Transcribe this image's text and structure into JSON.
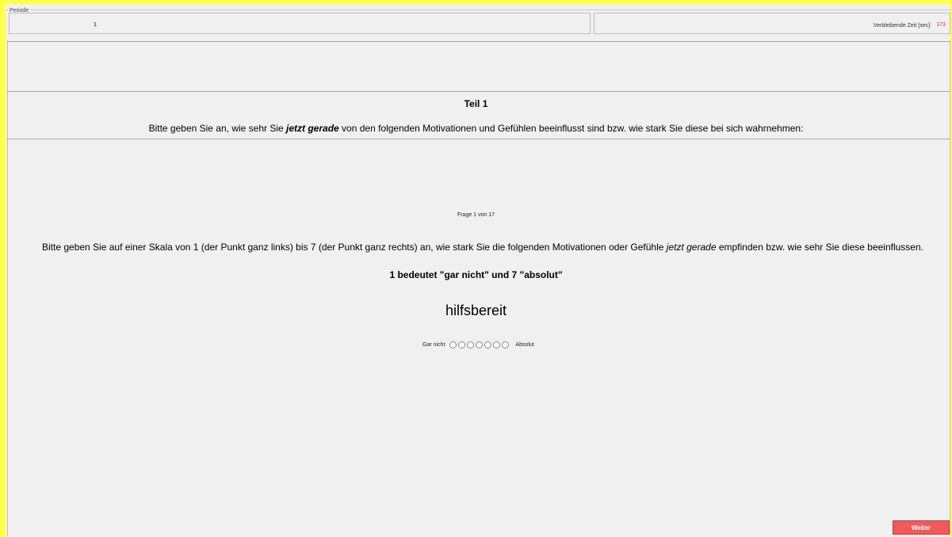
{
  "header": {
    "legend": "Periode",
    "periode_value": "1",
    "time_label": "Verbleibende Zeit [sec]:",
    "time_value": "173"
  },
  "intro": {
    "title": "Teil 1",
    "text_before": "Bitte geben Sie an, wie sehr Sie ",
    "text_emph": "jetzt gerade",
    "text_after": " von den folgenden Motivationen und Gefühlen beeinflusst sind bzw. wie stark Sie diese bei sich wahrnehmen:"
  },
  "question": {
    "counter": "Frage 1 von 17",
    "instr_before": "Bitte geben Sie auf einer Skala von 1 (der Punkt ganz links) bis 7 (der Punkt ganz rechts) an, wie stark Sie die folgenden Motivationen oder Gefühle ",
    "instr_emph": "jetzt gerade",
    "instr_after": " empfinden bzw. wie sehr Sie diese beeinflussen.",
    "scale_note": "1 bedeutet \"gar nicht\" und 7 \"absolut\"",
    "item": "hilfsbereit",
    "scale_min_label": "Gar nicht",
    "scale_max_label": "Absolut",
    "scale_points": 7,
    "selected": null
  },
  "footer": {
    "next_label": "Weiter"
  },
  "colors": {
    "frame": "#ffff4d",
    "button": "#f05a5a",
    "time": "#e03030"
  }
}
